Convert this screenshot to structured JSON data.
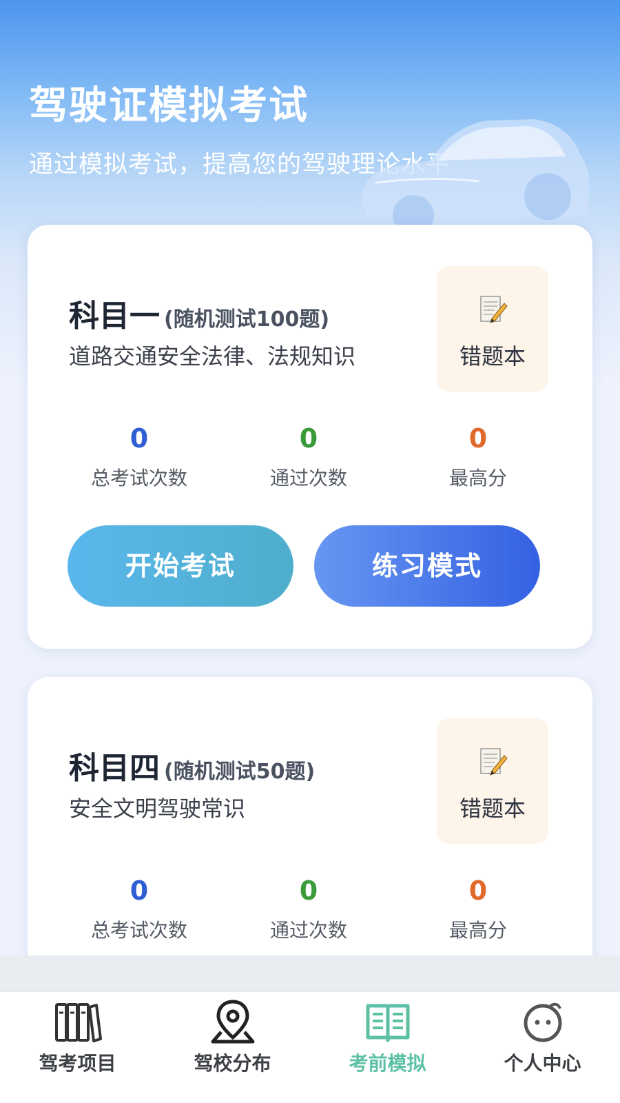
{
  "header": {
    "title": "驾驶证模拟考试",
    "subtitle": "通过模拟考试，提高您的驾驶理论水平"
  },
  "subjects": [
    {
      "name": "科目一",
      "note": "(随机测试100题)",
      "description": "道路交通安全法律、法规知识",
      "wrongbook_label": "错题本",
      "stats": [
        {
          "value": "0",
          "label": "总考试次数"
        },
        {
          "value": "0",
          "label": "通过次数"
        },
        {
          "value": "0",
          "label": "最高分"
        }
      ],
      "start_label": "开始考试",
      "practice_label": "练习模式"
    },
    {
      "name": "科目四",
      "note": "(随机测试50题)",
      "description": "安全文明驾驶常识",
      "wrongbook_label": "错题本",
      "stats": [
        {
          "value": "0",
          "label": "总考试次数"
        },
        {
          "value": "0",
          "label": "通过次数"
        },
        {
          "value": "0",
          "label": "最高分"
        }
      ]
    }
  ],
  "tabbar": {
    "active_index": 2,
    "items": [
      {
        "label": "驾考项目",
        "icon": "books-icon"
      },
      {
        "label": "驾校分布",
        "icon": "location-pin-icon"
      },
      {
        "label": "考前模拟",
        "icon": "open-book-icon"
      },
      {
        "label": "个人中心",
        "icon": "face-icon"
      }
    ]
  },
  "colors": {
    "accent_active_tab": "#5cc1a4",
    "stat_total": "#2f5fd3",
    "stat_passed": "#3a9b3a",
    "stat_best": "#e06a2c",
    "wrongbook_bg": "#fdf4ea"
  }
}
